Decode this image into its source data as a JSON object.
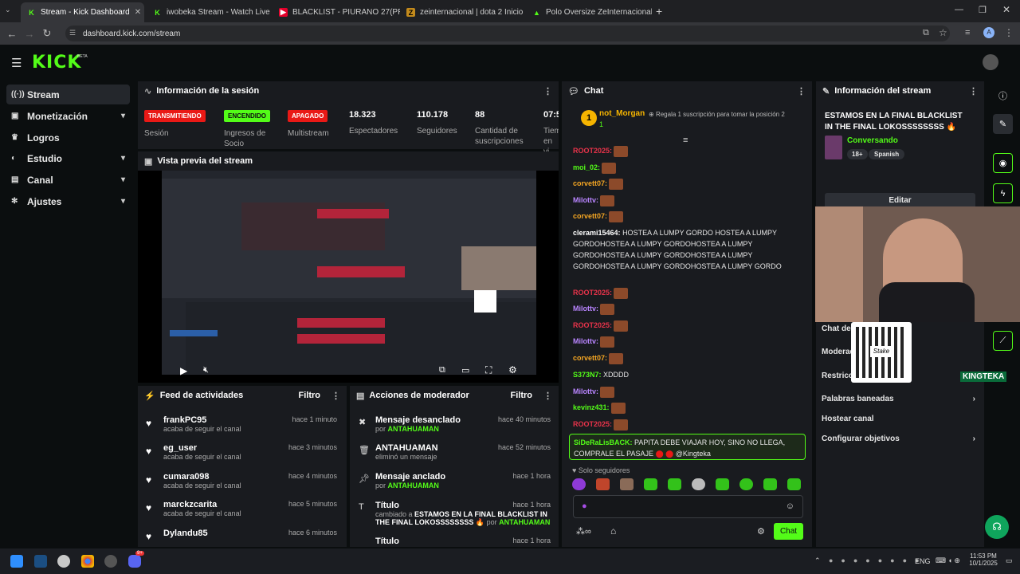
{
  "browser": {
    "tabs": [
      {
        "title": "Stream - Kick Dashboard"
      },
      {
        "title": "iwobeka Stream - Watch Live o"
      },
      {
        "title": "BLACKLIST - PIURANO 27(PRO"
      },
      {
        "title": "zeinternacional | dota 2 Inicio"
      },
      {
        "title": "Polo Oversize ZeInternacional 2"
      }
    ],
    "url": "dashboard.kick.com/stream"
  },
  "brand": {
    "logo": "KICK",
    "beta": "BETA",
    "accent": "#53fc18"
  },
  "sidebar": {
    "items": [
      {
        "label": "Stream",
        "icon": "broadcast-icon"
      },
      {
        "label": "Monetización",
        "icon": "wallet-icon"
      },
      {
        "label": "Logros",
        "icon": "trophy-icon"
      },
      {
        "label": "Estudio",
        "icon": "palette-icon"
      },
      {
        "label": "Canal",
        "icon": "channel-icon"
      },
      {
        "label": "Ajustes",
        "icon": "gear-icon"
      }
    ]
  },
  "session": {
    "title": "Información de la sesión",
    "stats": [
      {
        "badge": "TRANSMITIENDO",
        "label": "Sesión",
        "color": "#e91916"
      },
      {
        "badge": "ENCENDIDO",
        "label": "Ingresos de Socio",
        "color": "#53fc18"
      },
      {
        "badge": "APAGADO",
        "label": "Multistream",
        "color": "#e91916"
      },
      {
        "value": "18.323",
        "label": "Espectadores"
      },
      {
        "value": "110.178",
        "label": "Seguidores"
      },
      {
        "value": "88",
        "label": "Cantidad de suscripciones"
      },
      {
        "value": "07:5",
        "label": "Tiem en vi"
      }
    ]
  },
  "preview": {
    "title": "Vista previa del stream"
  },
  "feed": {
    "title": "Feed de actividades",
    "filter": "Filtro",
    "items": [
      {
        "name": "frankPC95",
        "sub": "acaba de seguir el canal",
        "time": "hace 1 minuto"
      },
      {
        "name": "eg_user",
        "sub": "acaba de seguir el canal",
        "time": "hace 3 minutos"
      },
      {
        "name": "cumara098",
        "sub": "acaba de seguir el canal",
        "time": "hace 4 minutos"
      },
      {
        "name": "marckzcarita",
        "sub": "acaba de seguir el canal",
        "time": "hace 5 minutos"
      },
      {
        "name": "Dylandu85",
        "sub": "",
        "time": "hace 6 minutos"
      }
    ]
  },
  "modactions": {
    "title": "Acciones de moderador",
    "filter": "Filtro",
    "items": [
      {
        "name": "Mensaje desanclado",
        "by": "por",
        "user": "ANTAHUAMAN",
        "time": "hace 40 minutos"
      },
      {
        "name": "ANTAHUAMAN",
        "by": "eliminó un mensaje",
        "user": "",
        "time": "hace 52 minutos"
      },
      {
        "name": "Mensaje anclado",
        "by": "por",
        "user": "ANTAHUAMAN",
        "time": "hace 1 hora"
      },
      {
        "name": "Título",
        "by": "cambiado a",
        "user": "ESTAMOS EN LA FINAL BLACKLIST IN THE FINAL LOKOSSSSSSSS",
        "tail": "por",
        "user2": "ANTAHUAMAN",
        "time": "hace 1 hora"
      },
      {
        "name": "Título",
        "by": "",
        "user": "",
        "time": "hace 1 hora"
      }
    ]
  },
  "chat": {
    "title": "Chat",
    "pinned": {
      "rank": "1",
      "user": "not_Morgan",
      "count": "1",
      "note": "Regala 1 suscripción para tomar la posición 2"
    },
    "messages": [
      {
        "user": "ROOT2025:",
        "color": "#e8334a",
        "text": ""
      },
      {
        "user": "moi_02:",
        "color": "#53fc18",
        "text": ""
      },
      {
        "user": "corvett07:",
        "color": "#f5a623",
        "text": ""
      },
      {
        "user": "Milottv:",
        "color": "#b985ff",
        "text": ""
      },
      {
        "user": "corvett07:",
        "color": "#f5a623",
        "text": ""
      },
      {
        "user": "clerami15464:",
        "color": "#ffffff",
        "text": "HOSTEA A LUMPY GORDO HOSTEA A LUMPY GORDOHOSTEA A LUMPY GORDOHOSTEA A LUMPY GORDOHOSTEA A LUMPY GORDOHOSTEA A LUMPY GORDOHOSTEA A LUMPY GORDOHOSTEA A LUMPY GORDO"
      },
      {
        "user": "ROOT2025:",
        "color": "#e8334a",
        "text": ""
      },
      {
        "user": "Milottv:",
        "color": "#b985ff",
        "text": ""
      },
      {
        "user": "ROOT2025:",
        "color": "#e8334a",
        "text": ""
      },
      {
        "user": "Milottv:",
        "color": "#b985ff",
        "text": ""
      },
      {
        "user": "corvett07:",
        "color": "#f5a623",
        "text": ""
      },
      {
        "user": "S373N7:",
        "color": "#53fc18",
        "text": "XDDDD"
      },
      {
        "user": "Milottv:",
        "color": "#b985ff",
        "text": ""
      },
      {
        "user": "kevinz431:",
        "color": "#53fc18",
        "text": ""
      },
      {
        "user": "ROOT2025:",
        "color": "#e8334a",
        "text": ""
      }
    ],
    "highlight": {
      "user": "SiDeRaLisBACK:",
      "text": "PAPITA DEBE VIAJAR HOY, SINO NO LLEGA, COMPRALE EL PASAJE",
      "mention": "@Kingteka"
    },
    "mode": "Solo seguidores",
    "send": "Chat"
  },
  "streaminfo": {
    "title": "Información del stream",
    "stream_title": "ESTAMOS EN LA FINAL BLACKLIST IN THE FINAL LOKOSSSSSSSS",
    "category": "Conversando",
    "tags": [
      "18+",
      "Spanish"
    ],
    "edit": "Editar",
    "menu": [
      "Chat de",
      "Moderad",
      "Restricc",
      "Palabras baneadas",
      "Hostear canal",
      "Configurar objetivos"
    ],
    "qr_label": "Stake",
    "sponsor": "KINGTEKA"
  },
  "taskbar": {
    "lang": "ENG",
    "time": "11:53 PM",
    "date": "10/1/2025",
    "badge": "9+"
  }
}
